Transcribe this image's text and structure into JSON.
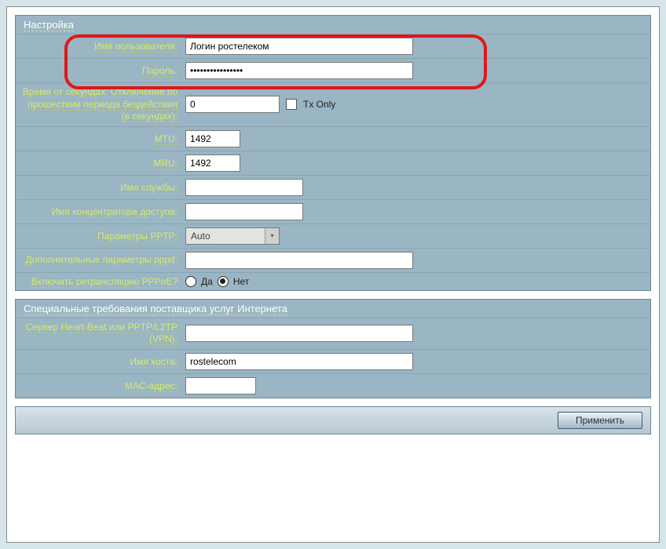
{
  "section1": {
    "legend": "Настройка",
    "username_label": "Имя пользователя:",
    "username_value": "Логин ростелеком",
    "password_label": "Пароль:",
    "password_value": "••••••••••••••••",
    "idle_label": "Время от             секундах: Отключение по прошествии периода бездействия (в секундах):",
    "idle_value": "0",
    "txonly_label": "Tx Only",
    "mtu_label": "MTU:",
    "mtu_value": "1492",
    "mru_label": "MRU:",
    "mru_value": "1492",
    "service_label": "Имя службы:",
    "service_value": "",
    "ac_label": "Имя концентратора доступа:",
    "ac_value": "",
    "pptp_label": "Параметры PPTP:",
    "pptp_value": "Auto",
    "pppd_label": "Дополнительные параметры pppd:",
    "pppd_value": "",
    "relay_label": "Включить ретрансляцию PPPoE?",
    "relay_yes": "Да",
    "relay_no": "Нет"
  },
  "section2": {
    "legend": "Специальные требования поставщика услуг Интернета",
    "heartbeat_label": "Сервер Heart-Beat или PPTP/L2TP (VPN):",
    "heartbeat_value": "",
    "hostname_label": "Имя хоста:",
    "hostname_value": "rostelecom",
    "mac_label": "MAC-адрес:",
    "mac_value": ""
  },
  "footer": {
    "apply_label": "Применить"
  }
}
